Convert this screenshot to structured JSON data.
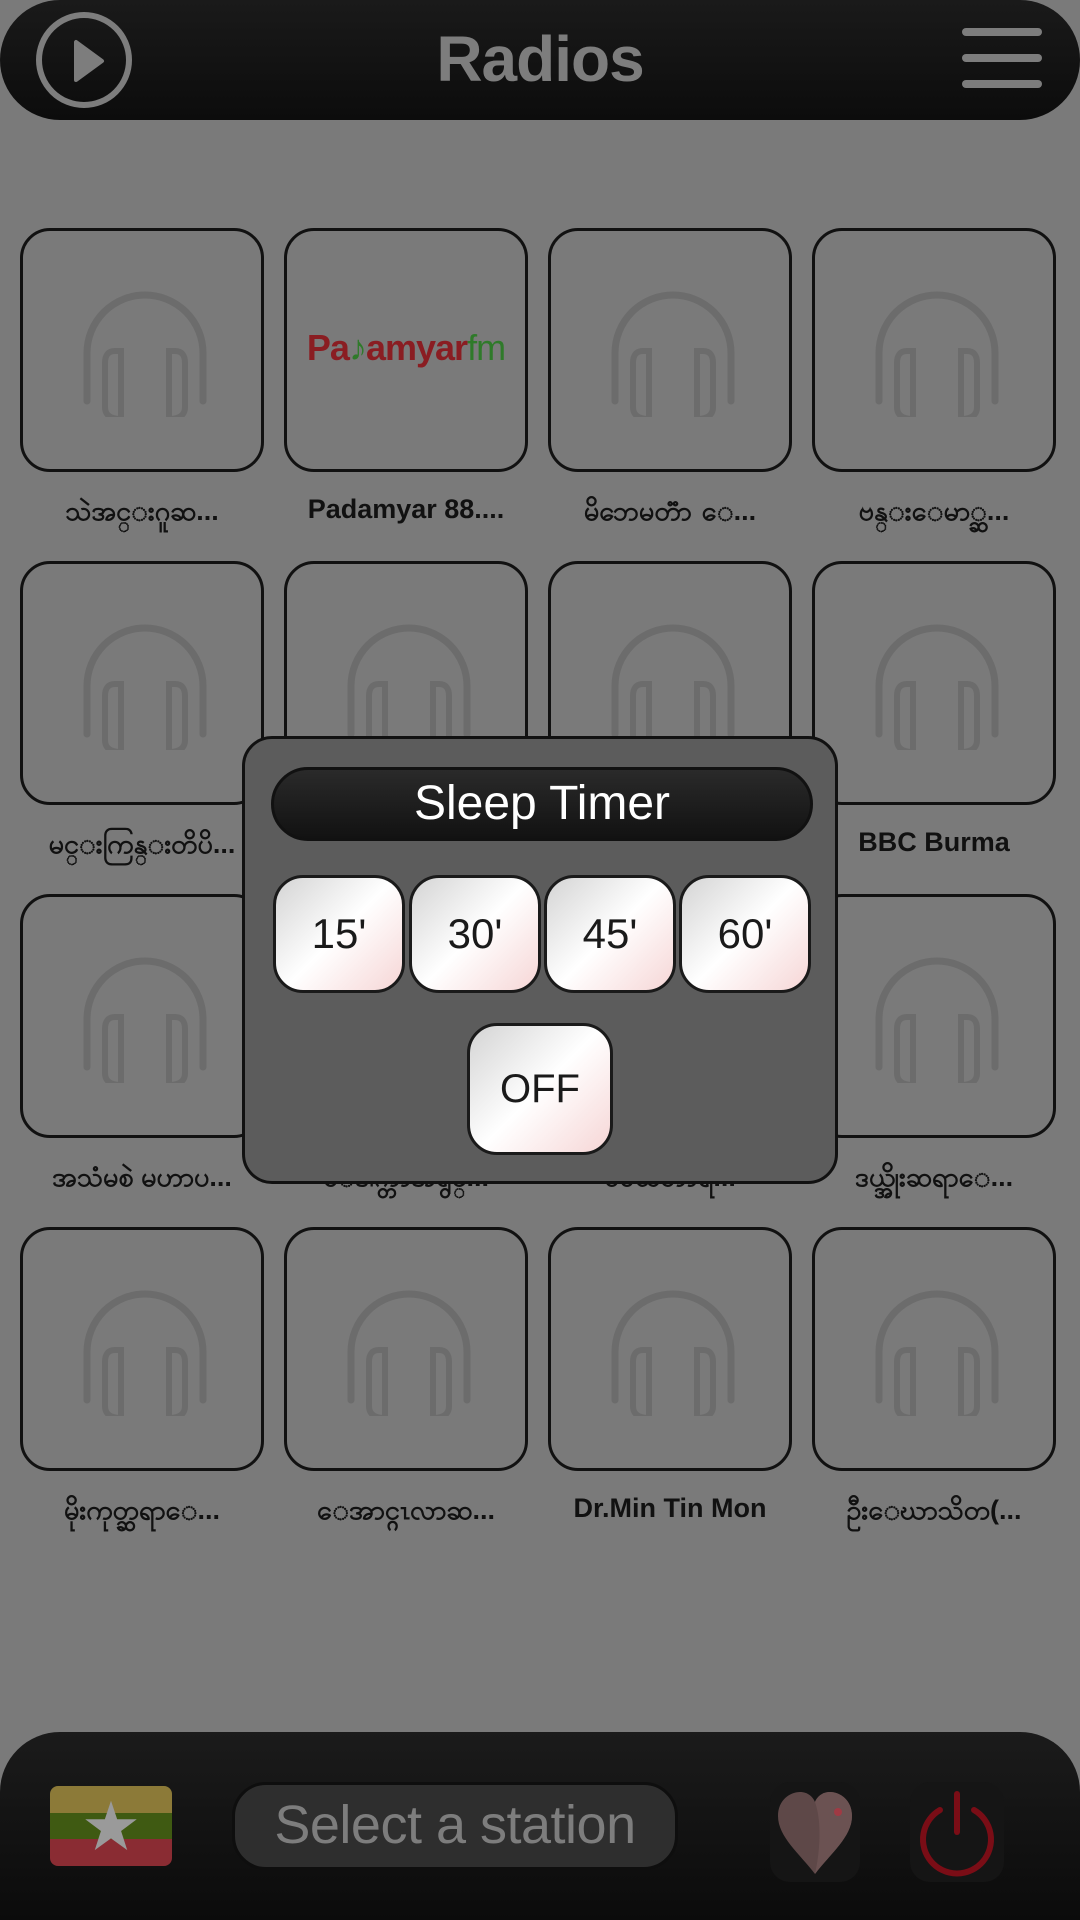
{
  "header": {
    "title": "Radios",
    "play_icon": "play-circle-icon",
    "menu_icon": "hamburger-menu-icon"
  },
  "stations": [
    {
      "label": "သဲအင္းဂူဆ...",
      "logo": "headphones-icon"
    },
    {
      "label": "Padamyar 88....",
      "logo": "padamyar-fm-logo"
    },
    {
      "label": "မိဘေမတၱာ ေ...",
      "logo": "headphones-icon"
    },
    {
      "label": "ဗန္းေမာ္ဆ...",
      "logo": "headphones-icon"
    },
    {
      "label": "မင္းကြန္းတိပိ...",
      "logo": "headphones-icon"
    },
    {
      "label": "",
      "logo": "headphones-icon"
    },
    {
      "label": "",
      "logo": "headphones-icon"
    },
    {
      "label": "BBC Burma",
      "logo": "headphones-icon"
    },
    {
      "label": "အသံမစဲ မဟာပ...",
      "logo": "headphones-icon"
    },
    {
      "label": "ေဒါက္တာအရွင္...",
      "logo": "headphones-icon"
    },
    {
      "label": "ဓမၼဘာရီ...",
      "logo": "headphones-icon"
    },
    {
      "label": "ဒယ္အိုးဆရာေ...",
      "logo": "headphones-icon"
    },
    {
      "label": "မိုးကုတ္ဆရာေ...",
      "logo": "headphones-icon"
    },
    {
      "label": "ေအာင္ဂၤလာဆ...",
      "logo": "headphones-icon"
    },
    {
      "label": "Dr.Min Tin Mon",
      "logo": "headphones-icon"
    },
    {
      "label": "ဦးေဃာသိတ(...",
      "logo": "headphones-icon"
    }
  ],
  "padamyar_logo": {
    "part1": "Pa",
    "part2": "♪",
    "part3": "amyar",
    "part4": "fm"
  },
  "sleep_timer": {
    "title": "Sleep Timer",
    "options": [
      "15'",
      "30'",
      "45'",
      "60'"
    ],
    "off_label": "OFF"
  },
  "footer": {
    "country_flag": "myanmar-flag",
    "station_placeholder": "Select a station",
    "favorite_icon": "heart-icon",
    "power_icon": "power-icon"
  },
  "colors": {
    "flag_yellow": "#8c7a38",
    "flag_green": "#3f5a12",
    "flag_red": "#8a2c33",
    "power_red": "#7a0d16",
    "heart": "#5e4848"
  }
}
